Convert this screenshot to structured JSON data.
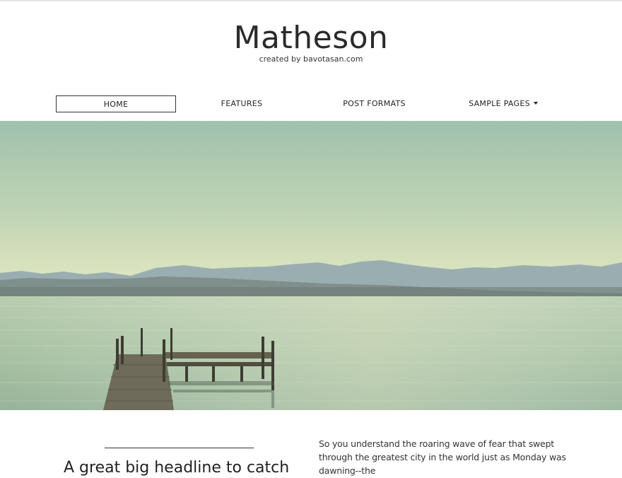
{
  "site": {
    "title": "Matheson",
    "tagline": "created by bavotasan.com"
  },
  "nav": {
    "items": [
      {
        "label": "HOME"
      },
      {
        "label": "FEATURES"
      },
      {
        "label": "POST FORMATS"
      },
      {
        "label": "SAMPLE PAGES"
      }
    ],
    "active": "HOME"
  },
  "hero": {
    "image": "lake-pier-landscape",
    "colors": {
      "sky_top": "#a3c4b0",
      "sky_bottom": "#e2e8c4",
      "water": "#b9ceb0",
      "mountains": "#8a9da6"
    }
  },
  "post": {
    "headline": "A great big headline to catch",
    "excerpt": "So you understand the roaring wave of fear that swept through the greatest city in the world just as Monday was dawning--the"
  }
}
